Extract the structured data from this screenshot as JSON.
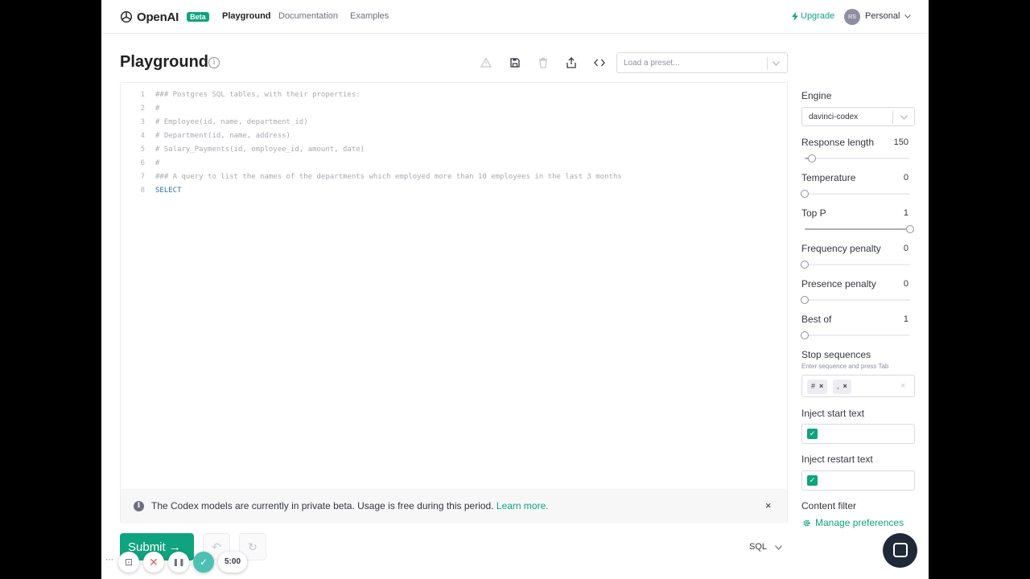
{
  "nav": {
    "logo": "OpenAI",
    "beta": "Beta",
    "links": [
      "Playground",
      "Documentation",
      "Examples"
    ],
    "upgrade": "Upgrade",
    "avatar": "RS",
    "account": "Personal"
  },
  "header": {
    "title": "Playground",
    "info": "i",
    "preset_placeholder": "Load a preset..."
  },
  "editor": {
    "lines": [
      {
        "n": "1",
        "text": "### Postgres SQL tables, with their properties:"
      },
      {
        "n": "2",
        "text": "#"
      },
      {
        "n": "3",
        "text": "# Employee(id, name, department_id)"
      },
      {
        "n": "4",
        "text": "# Department(id, name, address)"
      },
      {
        "n": "5",
        "text": "# Salary_Payments(id, employee_id, amount, date)"
      },
      {
        "n": "6",
        "text": "#"
      },
      {
        "n": "7",
        "text": "### A query to list the names of the departments which employed more than 10 employees in the last 3 months"
      },
      {
        "n": "8",
        "text": "SELECT"
      }
    ],
    "banner_icon": "i",
    "banner_text": "The Codex models are currently in private beta. Usage is free during this period. ",
    "banner_link": "Learn more.",
    "banner_close": "×"
  },
  "controls": {
    "submit": "Submit →",
    "undo": "↶",
    "regenerate": "↻",
    "language": "SQL",
    "language_chevron": "⌄"
  },
  "recorder": {
    "dots": "⋯",
    "camera": "⊡",
    "cancel": "✕",
    "pause": "❚❚",
    "done": "✓",
    "time": "5:00"
  },
  "panel": {
    "engine_label": "Engine",
    "engine_value": "davinci-codex",
    "response_length_label": "Response length",
    "response_length_value": "150",
    "response_length_level": 0.07,
    "temperature_label": "Temperature",
    "temperature_value": "0",
    "temperature_level": 0,
    "top_p_label": "Top P",
    "top_p_value": "1",
    "top_p_level": 1,
    "frequency_label": "Frequency penalty",
    "frequency_value": "0",
    "frequency_level": 0,
    "presence_label": "Presence penalty",
    "presence_value": "0",
    "presence_level": 0,
    "best_of_label": "Best of",
    "best_of_value": "1",
    "best_of_level": 0,
    "stop_label": "Stop sequences",
    "stop_hint": "Enter sequence and press Tab",
    "stop_chips": [
      "#",
      ","
    ],
    "chip_remove": "×",
    "stop_clear": "×",
    "inject_start_label": "Inject start text",
    "inject_restart_label": "Inject restart text",
    "checkmark": "✓",
    "content_filter_label": "Content filter",
    "manage_label": "Manage preferences"
  },
  "colors": {
    "accent": "#10a37f",
    "text": "#353740"
  }
}
